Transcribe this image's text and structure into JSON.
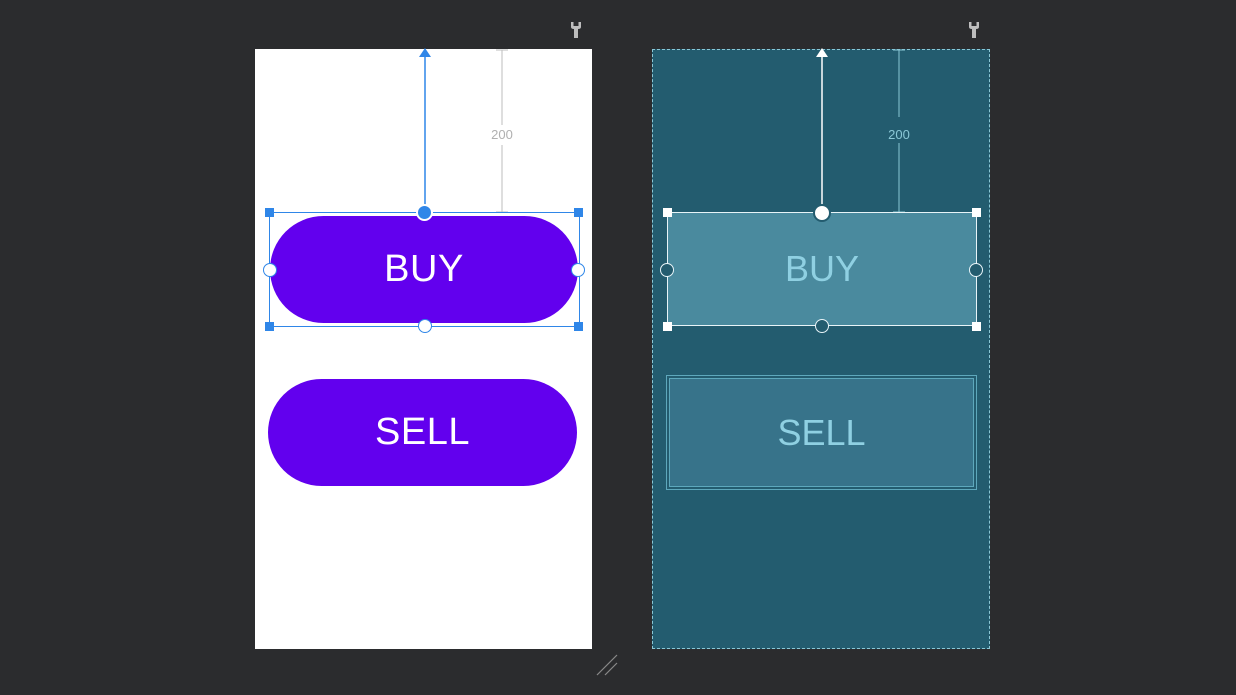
{
  "design": {
    "buy_label": "BUY",
    "sell_label": "SELL",
    "margin_value": "200"
  },
  "blueprint": {
    "buy_label": "BUY",
    "sell_label": "SELL",
    "margin_value": "200"
  },
  "icons": {
    "design_wrench": "wrench-icon",
    "blueprint_wrench": "wrench-icon",
    "resize": "resize-grip-icon"
  },
  "colors": {
    "canvas_bg": "#2b2c2e",
    "button_purple": "#6200ee",
    "selection_blue": "#2f86e8",
    "blueprint_bg": "#235c6f",
    "blueprint_text": "#8fd0e2"
  }
}
